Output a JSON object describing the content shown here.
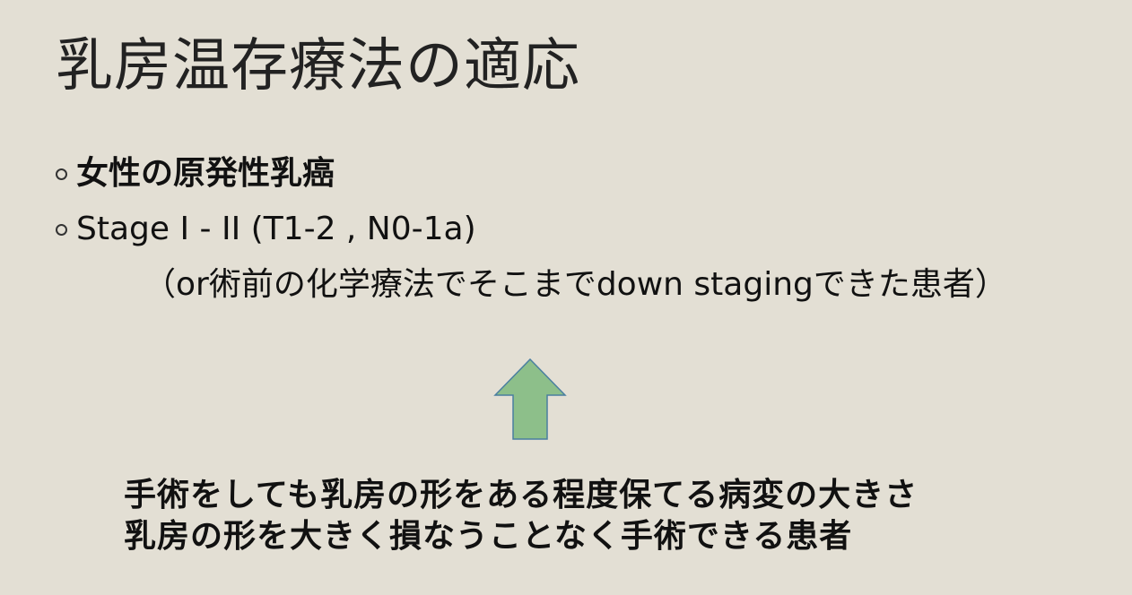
{
  "slide": {
    "title": "乳房温存療法の適応",
    "bullets": [
      {
        "text": "女性の原発性乳癌",
        "bold": true
      },
      {
        "text": "Stage I - II (T1-2 , N0-1a)",
        "bold": false
      }
    ],
    "note": "（or術前の化学療法でそこまでdown stagingできた患者）",
    "arrow": {
      "icon": "up-arrow-icon",
      "fill": "#8dbf8a",
      "stroke": "#4a7fa0"
    },
    "bottom_lines": [
      "手術をしても乳房の形をある程度保てる病変の大きさ",
      "乳房の形を大きく損なうことなく手術できる患者"
    ]
  }
}
